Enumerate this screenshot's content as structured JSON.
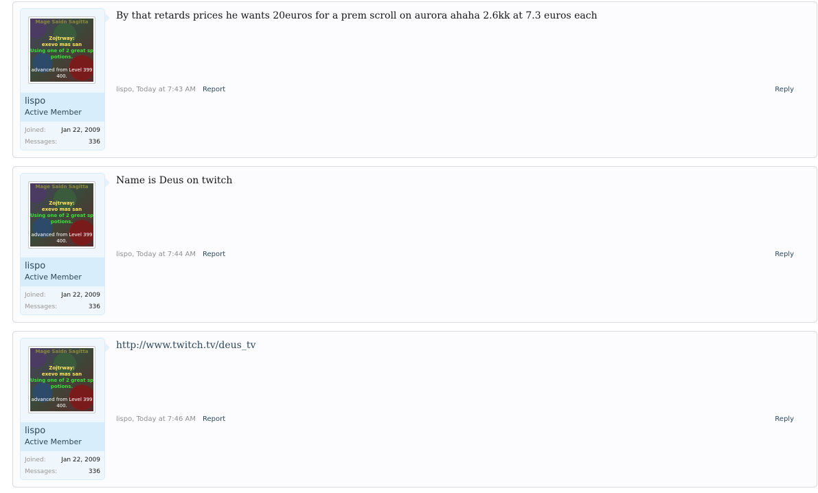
{
  "posts": [
    {
      "username": "lispo",
      "user_title": "Active Member",
      "joined_label": "Joined:",
      "joined_value": "Jan 22, 2009",
      "messages_label": "Messages:",
      "messages_value": "336",
      "message": "By that retards prices he wants 20euros for a prem scroll on aurora ahaha 2.6kk at 7.3 euros each",
      "meta": "lispo, Today at 7:43 AM",
      "report_label": "Report",
      "reply_label": "Reply"
    },
    {
      "username": "lispo",
      "user_title": "Active Member",
      "joined_label": "Joined:",
      "joined_value": "Jan 22, 2009",
      "messages_label": "Messages:",
      "messages_value": "336",
      "message": "Name is Deus on twitch",
      "meta": "lispo, Today at 7:44 AM",
      "report_label": "Report",
      "reply_label": "Reply"
    },
    {
      "username": "lispo",
      "user_title": "Active Member",
      "joined_label": "Joined:",
      "joined_value": "Jan 22, 2009",
      "messages_label": "Messages:",
      "messages_value": "336",
      "message": "http://www.twitch.tv/deus_tv",
      "meta": "lispo, Today at 7:46 AM",
      "report_label": "Report",
      "reply_label": "Reply"
    }
  ],
  "avatar_text": {
    "line1": "Mage Saidn   Sagitta",
    "line2": "Zojtrway:",
    "line3": "exevo mas san",
    "line4": "Using one of 2 great sp",
    "line5": "potions.",
    "line6": "advanced from Level 399",
    "line7": "400."
  },
  "colors": {
    "link": "#2b485c",
    "meta": "#8f8f8f",
    "panel": "#d7edfc"
  }
}
